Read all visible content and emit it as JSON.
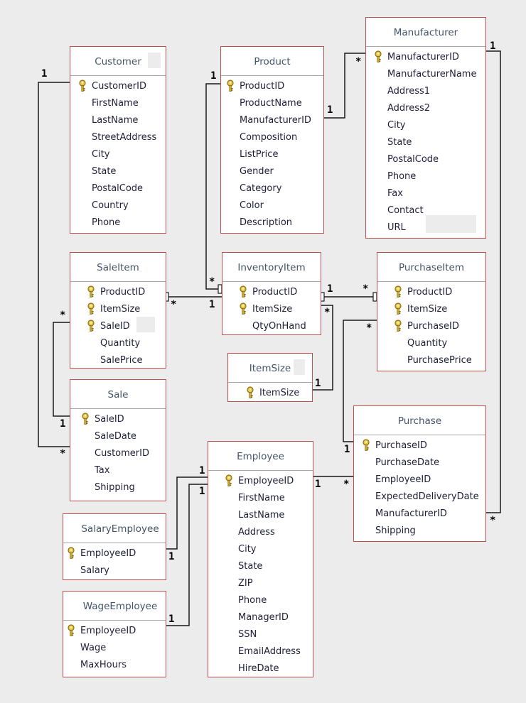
{
  "diagram": {
    "type": "database-relationships"
  },
  "tables": {
    "customer": {
      "title": "Customer",
      "fields": [
        {
          "name": "CustomerID",
          "pk": true
        },
        {
          "name": "FirstName"
        },
        {
          "name": "LastName"
        },
        {
          "name": "StreetAddress"
        },
        {
          "name": "City"
        },
        {
          "name": "State"
        },
        {
          "name": "PostalCode"
        },
        {
          "name": "Country"
        },
        {
          "name": "Phone"
        }
      ]
    },
    "product": {
      "title": "Product",
      "fields": [
        {
          "name": "ProductID",
          "pk": true
        },
        {
          "name": "ProductName"
        },
        {
          "name": "ManufacturerID"
        },
        {
          "name": "Composition"
        },
        {
          "name": "ListPrice"
        },
        {
          "name": "Gender"
        },
        {
          "name": "Category"
        },
        {
          "name": "Color"
        },
        {
          "name": "Description"
        }
      ]
    },
    "manufacturer": {
      "title": "Manufacturer",
      "fields": [
        {
          "name": "ManufacturerID",
          "pk": true
        },
        {
          "name": "ManufacturerName"
        },
        {
          "name": "Address1"
        },
        {
          "name": "Address2"
        },
        {
          "name": "City"
        },
        {
          "name": "State"
        },
        {
          "name": "PostalCode"
        },
        {
          "name": "Phone"
        },
        {
          "name": "Fax"
        },
        {
          "name": "Contact"
        },
        {
          "name": "URL"
        }
      ]
    },
    "saleitem": {
      "title": "SaleItem",
      "fields": [
        {
          "name": "ProductID",
          "pk": true
        },
        {
          "name": "ItemSize",
          "pk": true
        },
        {
          "name": "SaleID",
          "pk": true
        },
        {
          "name": "Quantity"
        },
        {
          "name": "SalePrice"
        }
      ]
    },
    "inventoryitem": {
      "title": "InventoryItem",
      "fields": [
        {
          "name": "ProductID",
          "pk": true
        },
        {
          "name": "ItemSize",
          "pk": true
        },
        {
          "name": "QtyOnHand"
        }
      ]
    },
    "purchaseitem": {
      "title": "PurchaseItem",
      "fields": [
        {
          "name": "ProductID",
          "pk": true
        },
        {
          "name": "ItemSize",
          "pk": true
        },
        {
          "name": "PurchaseID",
          "pk": true
        },
        {
          "name": "Quantity"
        },
        {
          "name": "PurchasePrice"
        }
      ]
    },
    "itemsize": {
      "title": "ItemSize",
      "fields": [
        {
          "name": "ItemSize",
          "pk": true
        }
      ]
    },
    "sale": {
      "title": "Sale",
      "fields": [
        {
          "name": "SaleID",
          "pk": true
        },
        {
          "name": "SaleDate"
        },
        {
          "name": "CustomerID"
        },
        {
          "name": "Tax"
        },
        {
          "name": "Shipping"
        }
      ]
    },
    "purchase": {
      "title": "Purchase",
      "fields": [
        {
          "name": "PurchaseID",
          "pk": true
        },
        {
          "name": "PurchaseDate"
        },
        {
          "name": "EmployeeID"
        },
        {
          "name": "ExpectedDeliveryDate"
        },
        {
          "name": "ManufacturerID"
        },
        {
          "name": "Shipping"
        }
      ]
    },
    "employee": {
      "title": "Employee",
      "fields": [
        {
          "name": "EmployeeID",
          "pk": true
        },
        {
          "name": "FirstName"
        },
        {
          "name": "LastName"
        },
        {
          "name": "Address"
        },
        {
          "name": "City"
        },
        {
          "name": "State"
        },
        {
          "name": "ZIP"
        },
        {
          "name": "Phone"
        },
        {
          "name": "ManagerID"
        },
        {
          "name": "SSN"
        },
        {
          "name": "EmailAddress"
        },
        {
          "name": "HireDate"
        }
      ]
    },
    "salaryemployee": {
      "title": "SalaryEmployee",
      "fields": [
        {
          "name": "EmployeeID",
          "pk": true
        },
        {
          "name": "Salary"
        }
      ]
    },
    "wageemployee": {
      "title": "WageEmployee",
      "fields": [
        {
          "name": "EmployeeID",
          "pk": true
        },
        {
          "name": "Wage"
        },
        {
          "name": "MaxHours"
        }
      ]
    }
  },
  "relationships": [
    {
      "from": "Customer.CustomerID",
      "to": "Sale.CustomerID",
      "from_card": "1",
      "to_card": "*"
    },
    {
      "from": "Product.ProductID",
      "to": "InventoryItem.ProductID",
      "from_card": "1",
      "to_card": "*"
    },
    {
      "from": "Manufacturer.ManufacturerID",
      "to": "Product.ManufacturerID",
      "from_card": "*",
      "to_card": "1"
    },
    {
      "from": "Manufacturer.ManufacturerID",
      "to": "Purchase.ManufacturerID",
      "from_card": "1",
      "to_card": "*"
    },
    {
      "from": "InventoryItem.ProductID",
      "to": "SaleItem.ProductID",
      "from_card": "1",
      "to_card": "*"
    },
    {
      "from": "InventoryItem.ProductID",
      "to": "PurchaseItem.ProductID",
      "from_card": "1",
      "to_card": "*"
    },
    {
      "from": "ItemSize.ItemSize",
      "to": "InventoryItem.ItemSize",
      "from_card": "1",
      "to_card": "*"
    },
    {
      "from": "Sale.SaleID",
      "to": "SaleItem.SaleID",
      "from_card": "1",
      "to_card": "*"
    },
    {
      "from": "Purchase.PurchaseID",
      "to": "PurchaseItem.PurchaseID",
      "from_card": "1",
      "to_card": "*"
    },
    {
      "from": "Employee.EmployeeID",
      "to": "Purchase.EmployeeID",
      "from_card": "1",
      "to_card": "*"
    },
    {
      "from": "Employee.EmployeeID",
      "to": "SalaryEmployee.EmployeeID",
      "from_card": "1",
      "to_card": "1"
    },
    {
      "from": "Employee.EmployeeID",
      "to": "WageEmployee.EmployeeID",
      "from_card": "1",
      "to_card": "1"
    }
  ],
  "cardinality": {
    "one": "1",
    "many": "*"
  },
  "colors": {
    "border": "#c0504d",
    "title": "#44546a",
    "line": "#000000",
    "background": "#ececec"
  }
}
